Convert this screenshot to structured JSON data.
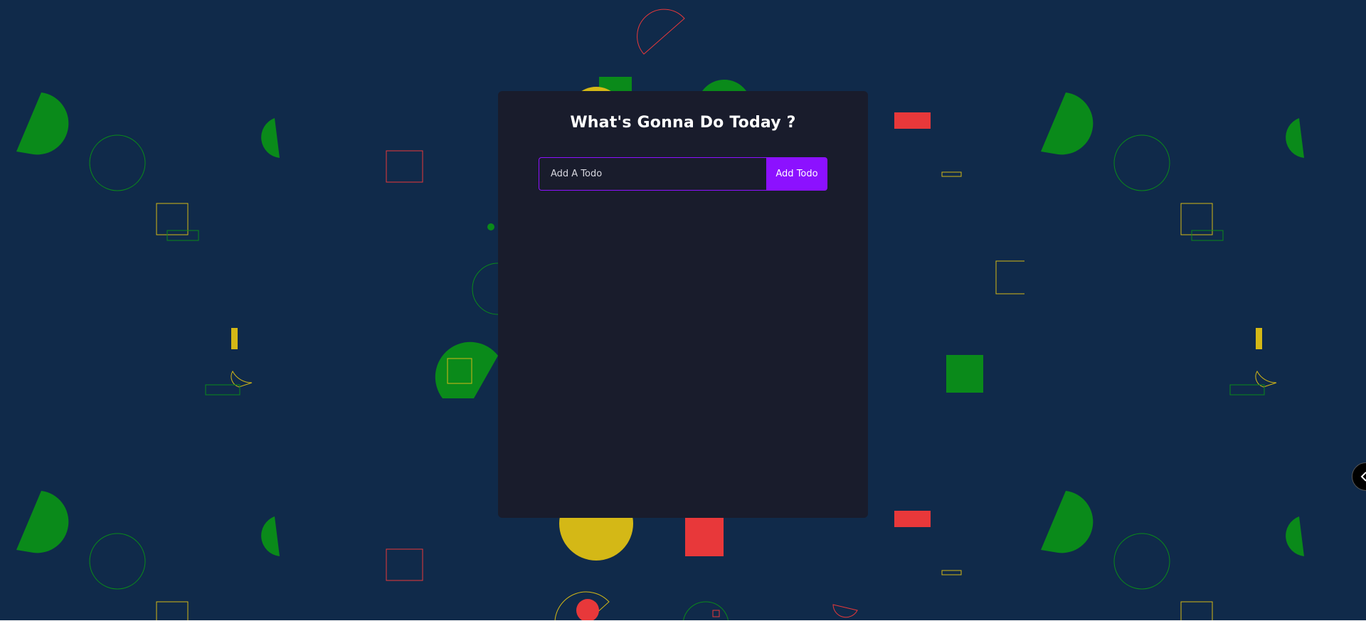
{
  "app": {
    "title": "What's Gonna Do Today ?"
  },
  "form": {
    "input_placeholder": "Add A Todo",
    "input_value": "",
    "button_label": "Add Todo"
  },
  "todos": [],
  "colors": {
    "background": "#102a4a",
    "card": "#191c2c",
    "accent": "#8c11ff",
    "shape_green": "#0a8a1a",
    "shape_yellow": "#d4b816",
    "shape_red": "#e8383a"
  },
  "icons": {
    "edge_toggle": "chevron-left-icon"
  }
}
